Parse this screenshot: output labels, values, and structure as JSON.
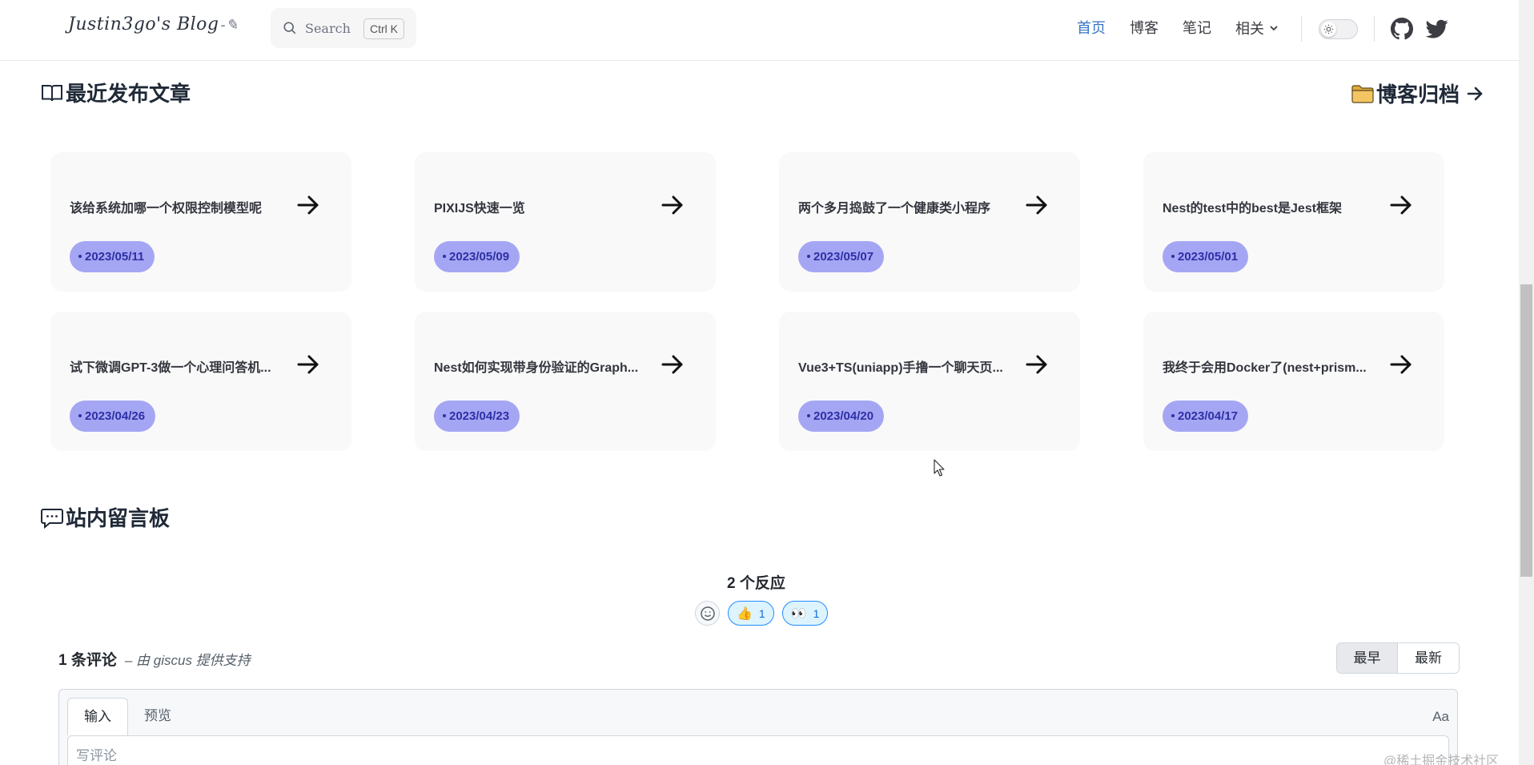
{
  "header": {
    "logo_text": "Justin3go's Blog",
    "search": {
      "placeholder": "Search",
      "shortcut": "Ctrl K"
    },
    "nav": {
      "home": "首页",
      "blog": "博客",
      "notes": "笔记",
      "related": "相关"
    }
  },
  "recent": {
    "title": "最近发布文章",
    "archive_link": "博客归档",
    "posts": [
      {
        "title": "该给系统加哪一个权限控制模型呢",
        "date": "2023/05/11"
      },
      {
        "title": "PIXIJS快速一览",
        "date": "2023/05/09"
      },
      {
        "title": "两个多月捣鼓了一个健康类小程序",
        "date": "2023/05/07"
      },
      {
        "title": "Nest的test中的best是Jest框架",
        "date": "2023/05/01"
      },
      {
        "title": "试下微调GPT-3做一个心理问答机...",
        "date": "2023/04/26"
      },
      {
        "title": "Nest如何实现带身份验证的Graph...",
        "date": "2023/04/23"
      },
      {
        "title": "Vue3+TS(uniapp)手撸一个聊天页...",
        "date": "2023/04/20"
      },
      {
        "title": "我终于会用Docker了(nest+prism...",
        "date": "2023/04/17"
      }
    ]
  },
  "guestbook": {
    "title": "站内留言板",
    "reactions_label": "2 个反应",
    "reactions": [
      {
        "emoji": "👍",
        "count": "1"
      },
      {
        "emoji": "👀",
        "count": "1"
      }
    ],
    "comment_count": "1 条评论",
    "powered_by": "– 由 giscus 提供支持",
    "sort": {
      "oldest": "最早",
      "newest": "最新"
    },
    "editor": {
      "tab_write": "输入",
      "tab_preview": "预览",
      "format": "Aa",
      "placeholder": "写评论"
    }
  },
  "watermark": "@稀土掘金技术社区"
}
